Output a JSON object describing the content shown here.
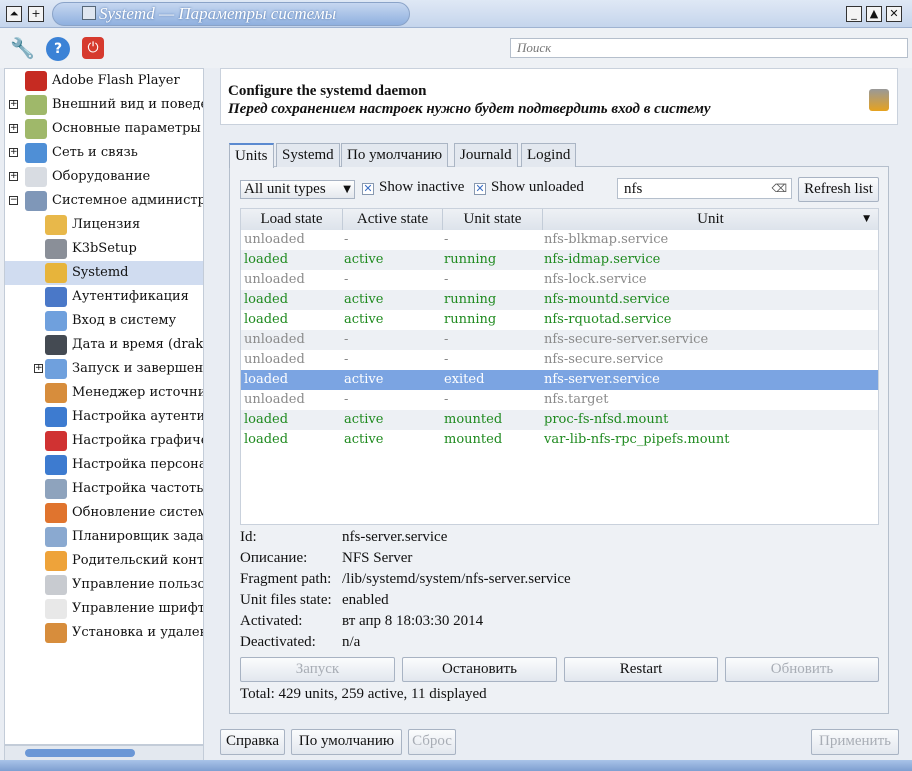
{
  "window": {
    "title": "Systemd — Параметры системы"
  },
  "toolbar": {
    "search_placeholder": "Поиск"
  },
  "tree": {
    "items": [
      {
        "label": "Adobe Flash Player",
        "level": 0,
        "expander": "",
        "color": "#c62b22"
      },
      {
        "label": "Внешний вид и поведение",
        "level": 0,
        "expander": "+",
        "color": "#9fb86a"
      },
      {
        "label": "Основные параметры рабочей среды",
        "level": 0,
        "expander": "+",
        "color": "#9fb86a"
      },
      {
        "label": "Сеть и связь",
        "level": 0,
        "expander": "+",
        "color": "#4f8fd6"
      },
      {
        "label": "Оборудование",
        "level": 0,
        "expander": "+",
        "color": "#d8dce2"
      },
      {
        "label": "Системное администрирование",
        "level": 0,
        "expander": "−",
        "color": "#7f97b8"
      },
      {
        "label": "Лицензия",
        "level": 1,
        "color": "#e8b84a"
      },
      {
        "label": "K3bSetup",
        "level": 1,
        "color": "#8a8f98"
      },
      {
        "label": "Systemd",
        "level": 1,
        "color": "#e7b43b",
        "selected": true
      },
      {
        "label": "Аутентификация",
        "level": 1,
        "color": "#4a78c8"
      },
      {
        "label": "Вход в систему",
        "level": 1,
        "color": "#6fa0dd"
      },
      {
        "label": "Дата и время (drakclock)",
        "level": 1,
        "color": "#444a52"
      },
      {
        "label": "Запуск и завершение",
        "level": 1,
        "expander": "+",
        "color": "#6fa0dd"
      },
      {
        "label": "Менеджер источников",
        "level": 1,
        "color": "#d78d3c"
      },
      {
        "label": "Настройка аутентификации",
        "level": 1,
        "color": "#3d7bd0"
      },
      {
        "label": "Настройка графического сервера",
        "level": 1,
        "color": "#d03232"
      },
      {
        "label": "Настройка персонального брандмауэра",
        "level": 1,
        "color": "#3d7bd0"
      },
      {
        "label": "Настройка частоты процессора",
        "level": 1,
        "color": "#8ea3bd"
      },
      {
        "label": "Обновление системы",
        "level": 1,
        "color": "#e0742e"
      },
      {
        "label": "Планировщик заданий",
        "level": 1,
        "color": "#8aa9d0"
      },
      {
        "label": "Родительский контроль",
        "level": 1,
        "color": "#eea33a"
      },
      {
        "label": "Управление пользователями",
        "level": 1,
        "color": "#c8cbd0"
      },
      {
        "label": "Управление шрифтами",
        "level": 1,
        "color": "#e8e8e8"
      },
      {
        "label": "Установка и удаление программ",
        "level": 1,
        "color": "#d78d3c"
      }
    ]
  },
  "header": {
    "title": "Configure the systemd daemon",
    "subtitle": "Перед сохранением настроек нужно будет подтвердить вход в систему"
  },
  "tabs": [
    "Units",
    "Systemd",
    "По умолчанию",
    "Journald",
    "Logind"
  ],
  "units": {
    "type_filter": "All unit types",
    "show_inactive": {
      "label": "Show inactive",
      "checked": true
    },
    "show_unloaded": {
      "label": "Show unloaded",
      "checked": true
    },
    "filter_value": "nfs",
    "refresh_label": "Refresh list",
    "columns": [
      "Load state",
      "Active state",
      "Unit state",
      "Unit"
    ],
    "rows": [
      [
        "unloaded",
        "-",
        "-",
        "nfs-blkmap.service"
      ],
      [
        "loaded",
        "active",
        "running",
        "nfs-idmap.service"
      ],
      [
        "unloaded",
        "-",
        "-",
        "nfs-lock.service"
      ],
      [
        "loaded",
        "active",
        "running",
        "nfs-mountd.service"
      ],
      [
        "loaded",
        "active",
        "running",
        "nfs-rquotad.service"
      ],
      [
        "unloaded",
        "-",
        "-",
        "nfs-secure-server.service"
      ],
      [
        "unloaded",
        "-",
        "-",
        "nfs-secure.service"
      ],
      [
        "loaded",
        "active",
        "exited",
        "nfs-server.service"
      ],
      [
        "unloaded",
        "-",
        "-",
        "nfs.target"
      ],
      [
        "loaded",
        "active",
        "mounted",
        "proc-fs-nfsd.mount"
      ],
      [
        "loaded",
        "active",
        "mounted",
        "var-lib-nfs-rpc_pipefs.mount"
      ]
    ],
    "selected_row": 7,
    "details": [
      {
        "label": "Id:",
        "value": "nfs-server.service"
      },
      {
        "label": "Описание:",
        "value": "NFS Server"
      },
      {
        "label": "Fragment path:",
        "value": "/lib/systemd/system/nfs-server.service"
      },
      {
        "label": "Unit files state:",
        "value": "enabled"
      },
      {
        "label": "Activated:",
        "value": "вт апр 8 18:03:30 2014"
      },
      {
        "label": "Deactivated:",
        "value": "n/a"
      }
    ],
    "actions": {
      "start": "Запуск",
      "stop": "Остановить",
      "restart": "Restart",
      "reload": "Обновить"
    },
    "total": "Total: 429 units, 259 active, 11 displayed"
  },
  "footer": {
    "help": "Справка",
    "defaults": "По умолчанию",
    "reset": "Сброс",
    "apply": "Применить"
  },
  "colors": {
    "loaded": "#1f8a1f",
    "unloaded": "#8a8a8a",
    "selection": "#7ba4e2"
  }
}
